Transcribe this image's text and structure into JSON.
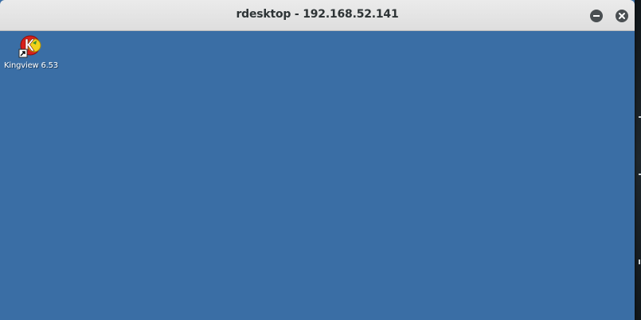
{
  "window": {
    "title": "rdesktop - 192.168.52.141",
    "minimize_icon": "minimize-icon",
    "close_icon": "close-icon"
  },
  "desktop": {
    "background_color": "#3a6ea5",
    "icons": [
      {
        "label": "Kingview 6.53",
        "icon": "kingview-app-icon",
        "shortcut_overlay": "shortcut-arrow-icon"
      }
    ]
  }
}
